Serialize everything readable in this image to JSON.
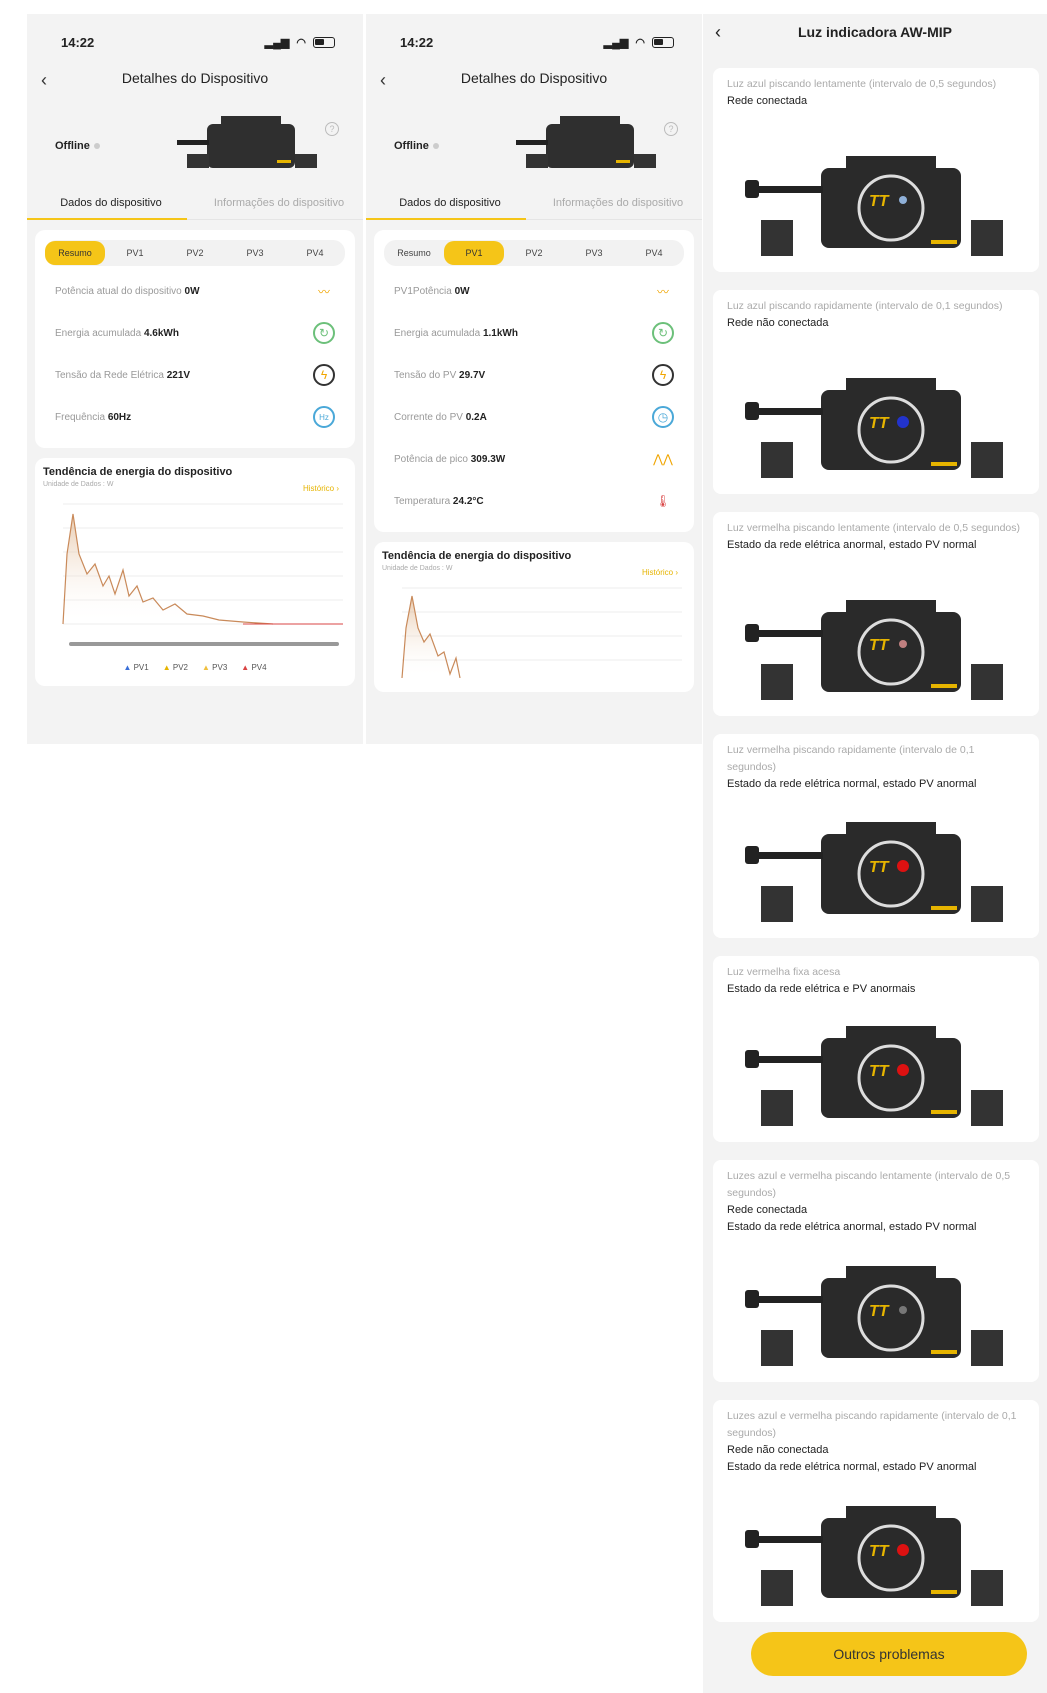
{
  "colors": {
    "accent": "#f5c518",
    "card": "#ffffff",
    "bg": "#f3f3f3",
    "blue_led": "#2233cc",
    "red_led": "#dd1111"
  },
  "phone1": {
    "time": "14:22",
    "title": "Detalhes do Dispositivo",
    "status": "Offline",
    "tab_active": "Dados do dispositivo",
    "tab_inactive": "Informações do dispositivo",
    "segments": [
      "Resumo",
      "PV1",
      "PV2",
      "PV3",
      "PV4"
    ],
    "selected_segment": "Resumo",
    "rows": [
      {
        "label": "Potência atual do dispositivo",
        "value": "0W",
        "icon": "power-wave-icon"
      },
      {
        "label": "Energia acumulada",
        "value": "4.6kWh",
        "icon": "energy-cycle-icon"
      },
      {
        "label": "Tensão da Rede Elétrica",
        "value": "221V",
        "icon": "voltage-bolt-icon"
      },
      {
        "label": "Frequência",
        "value": "60Hz",
        "icon": "frequency-hz-icon"
      }
    ],
    "trend_title": "Tendência de energia do dispositivo",
    "trend_unit": "Unidade de Dados : W",
    "trend_history": "Histórico",
    "legend": [
      "PV1",
      "PV2",
      "PV3",
      "PV4"
    ]
  },
  "phone2": {
    "time": "14:22",
    "title": "Detalhes do Dispositivo",
    "status": "Offline",
    "tab_active": "Dados do dispositivo",
    "tab_inactive": "Informações do dispositivo",
    "segments": [
      "Resumo",
      "PV1",
      "PV2",
      "PV3",
      "PV4"
    ],
    "selected_segment": "PV1",
    "rows": [
      {
        "label": "PV1Potência",
        "value": "0W",
        "icon": "power-wave-icon"
      },
      {
        "label": "Energia acumulada",
        "value": "1.1kWh",
        "icon": "energy-cycle-icon"
      },
      {
        "label": "Tensão do PV",
        "value": "29.7V",
        "icon": "voltage-bolt-icon"
      },
      {
        "label": "Corrente do PV",
        "value": "0.2A",
        "icon": "current-gauge-icon"
      },
      {
        "label": "Potência de pico",
        "value": "309.3W",
        "icon": "peak-power-icon"
      },
      {
        "label": "Temperatura",
        "value": "24.2°C",
        "icon": "thermometer-icon"
      }
    ],
    "trend_title": "Tendência de energia do dispositivo",
    "trend_unit": "Unidade de Dados : W",
    "trend_history": "Histórico"
  },
  "phone3": {
    "title": "Luz indicadora AW-MIP",
    "cards": [
      {
        "desc": "Luz azul piscando lentamente (intervalo de 0,5 segundos)",
        "states": [
          "Rede conectada"
        ],
        "led": "blue-dim"
      },
      {
        "desc": "Luz azul piscando rapidamente (intervalo de 0,1 segundos)",
        "states": [
          "Rede não conectada"
        ],
        "led": "blue"
      },
      {
        "desc": "Luz vermelha piscando lentamente (intervalo de 0,5 segundos)",
        "states": [
          "Estado da rede elétrica anormal, estado PV normal"
        ],
        "led": "red-dim"
      },
      {
        "desc": "Luz vermelha piscando rapidamente (intervalo de 0,1 segundos)",
        "states": [
          "Estado da rede elétrica normal, estado PV anormal"
        ],
        "led": "red"
      },
      {
        "desc": "Luz vermelha fixa acesa",
        "states": [
          "Estado da rede elétrica e PV anormais"
        ],
        "led": "red"
      },
      {
        "desc": "Luzes azul e vermelha piscando lentamente (intervalo de 0,5 segundos)",
        "states": [
          "Rede conectada",
          "Estado da rede elétrica anormal, estado PV normal"
        ],
        "led": "dim"
      },
      {
        "desc": "Luzes azul e vermelha piscando rapidamente (intervalo de 0,1 segundos)",
        "states": [
          "Rede não conectada",
          "Estado da rede elétrica normal, estado PV anormal"
        ],
        "led": "red"
      }
    ],
    "button": "Outros problemas"
  }
}
